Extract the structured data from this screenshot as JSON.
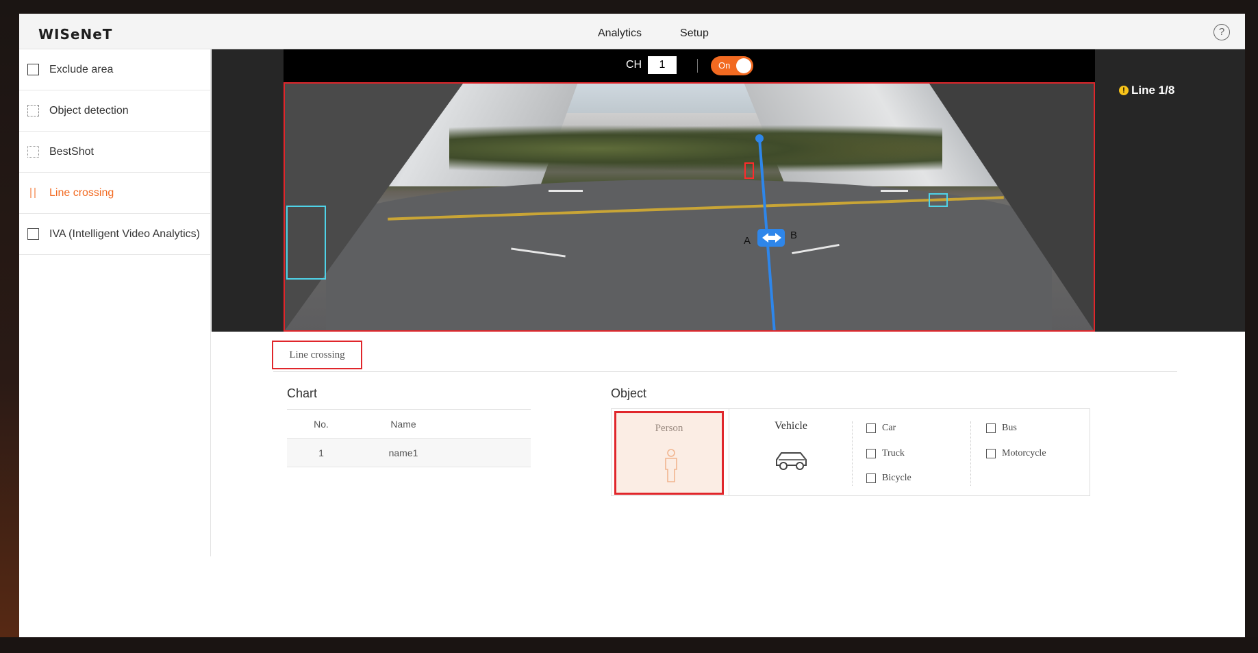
{
  "header": {
    "logo": "WISeNeT",
    "nav": [
      "Analytics",
      "Setup"
    ],
    "help": "?"
  },
  "sidebar": {
    "items": [
      {
        "label": "Exclude area",
        "icon": "exclude-area-icon",
        "active": false
      },
      {
        "label": "Object detection",
        "icon": "object-detection-icon",
        "active": false
      },
      {
        "label": "BestShot",
        "icon": "bestshot-icon",
        "active": false
      },
      {
        "label": "Line crossing",
        "icon": "line-crossing-icon",
        "active": true
      },
      {
        "label": "IVA (Intelligent Video Analytics)",
        "icon": "iva-icon",
        "active": false
      }
    ]
  },
  "video": {
    "ch_label": "CH",
    "ch_value": "1",
    "toggle_label": "On",
    "toggle_state": true,
    "line_indicator": "Line 1/8",
    "line_end_a": "A",
    "line_end_b": "B"
  },
  "tabs": {
    "active": "Line crossing"
  },
  "chart": {
    "title": "Chart",
    "headers": {
      "no": "No.",
      "name": "Name"
    },
    "rows": [
      {
        "no": "1",
        "name": "name1"
      }
    ]
  },
  "object": {
    "title": "Object",
    "person_label": "Person",
    "vehicle_label": "Vehicle",
    "vehicle_types": [
      "Car",
      "Bus",
      "Truck",
      "Motorcycle",
      "Bicycle"
    ]
  },
  "colors": {
    "accent": "#f26a21",
    "selection_red": "#e0262b",
    "line_blue": "#2e86ea",
    "detection_cyan": "#4fd3e8"
  }
}
